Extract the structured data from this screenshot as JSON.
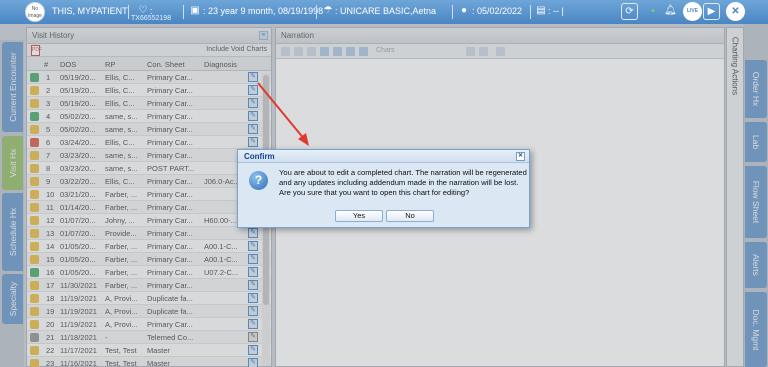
{
  "header": {
    "photo_label": "No Image",
    "patient_name": "THIS, MYPATIENT",
    "chart_id": "TX66552198",
    "age_dob": ": 23 year 9 month, 08/19/1998",
    "insurance": ": UNICARE BASIC,Aetna",
    "visit_date": ": 05/02/2022",
    "misc": ": -- |",
    "badge_label": "LIVE"
  },
  "left_tabs": [
    "Current Encounter",
    "Visit Hx",
    "Schedule Hx",
    "Specialty"
  ],
  "right_tabs": [
    "Order Hx",
    "Lab",
    "Flow Sheet",
    "Alerts",
    "Doc. Mgmt"
  ],
  "visit_history": {
    "title": "Visit History",
    "include_void": "Include Void Charts",
    "pdf_label": "PDF",
    "columns": [
      "#",
      "DOS",
      "RP",
      "Con. Sheet",
      "Diagnosis"
    ],
    "rows": [
      {
        "num": "1",
        "dos": "05/19/20...",
        "rp": "Ellis, C...",
        "sheet": "Primary Car...",
        "dx": "",
        "color": "#3aa55c"
      },
      {
        "num": "2",
        "dos": "05/19/20...",
        "rp": "Ellis, C...",
        "sheet": "Primary Car...",
        "dx": "",
        "color": "#e8b830"
      },
      {
        "num": "3",
        "dos": "05/19/20...",
        "rp": "Ellis, C...",
        "sheet": "Primary Car...",
        "dx": "",
        "color": "#e8b830"
      },
      {
        "num": "4",
        "dos": "05/02/20...",
        "rp": "same, s...",
        "sheet": "Primary Car...",
        "dx": "",
        "color": "#3aa55c"
      },
      {
        "num": "5",
        "dos": "05/02/20...",
        "rp": "same, s...",
        "sheet": "Primary Car...",
        "dx": "",
        "color": "#e8b830"
      },
      {
        "num": "6",
        "dos": "03/24/20...",
        "rp": "Ellis, C...",
        "sheet": "Primary Car...",
        "dx": "",
        "color": "#d84a3a"
      },
      {
        "num": "7",
        "dos": "03/23/20...",
        "rp": "same, s...",
        "sheet": "Primary Car...",
        "dx": "",
        "color": "#e8b830"
      },
      {
        "num": "8",
        "dos": "03/23/20...",
        "rp": "same, s...",
        "sheet": "POST PART...",
        "dx": "",
        "color": "#e8b830"
      },
      {
        "num": "9",
        "dos": "03/22/20...",
        "rp": "Ellis, C...",
        "sheet": "Primary Car...",
        "dx": "J06.0-Ac...",
        "color": "#e8b830"
      },
      {
        "num": "10",
        "dos": "03/21/20...",
        "rp": "Farber, ...",
        "sheet": "Primary Car...",
        "dx": "",
        "color": "#e8b830"
      },
      {
        "num": "11",
        "dos": "01/14/20...",
        "rp": "Farber, ...",
        "sheet": "Primary Car...",
        "dx": "",
        "color": "#e8b830"
      },
      {
        "num": "12",
        "dos": "01/07/20...",
        "rp": "Johny, ...",
        "sheet": "Primary Car...",
        "dx": "H60.00-...",
        "color": "#e8b830"
      },
      {
        "num": "13",
        "dos": "01/07/20...",
        "rp": "Provide...",
        "sheet": "Primary Car...",
        "dx": "",
        "color": "#e8b830"
      },
      {
        "num": "14",
        "dos": "01/05/20...",
        "rp": "Farber, ...",
        "sheet": "Primary Car...",
        "dx": "A00.1-C...",
        "color": "#e8b830"
      },
      {
        "num": "15",
        "dos": "01/05/20...",
        "rp": "Farber, ...",
        "sheet": "Primary Car...",
        "dx": "A00.1-C...",
        "color": "#e8b830"
      },
      {
        "num": "16",
        "dos": "01/05/20...",
        "rp": "Farber, ...",
        "sheet": "Primary Car...",
        "dx": "U07.2-C...",
        "color": "#3aa55c"
      },
      {
        "num": "17",
        "dos": "11/30/2021",
        "rp": "Farber, ...",
        "sheet": "Primary Car...",
        "dx": "",
        "color": "#e8b830"
      },
      {
        "num": "18",
        "dos": "11/19/2021",
        "rp": "A, Provi...",
        "sheet": "Duplicate fa...",
        "dx": "",
        "color": "#e8b830"
      },
      {
        "num": "19",
        "dos": "11/19/2021",
        "rp": "A, Provi...",
        "sheet": "Duplicate fa...",
        "dx": "",
        "color": "#e8b830"
      },
      {
        "num": "20",
        "dos": "11/19/2021",
        "rp": "A, Provi...",
        "sheet": "Primary Car...",
        "dx": "",
        "color": "#e8b830"
      },
      {
        "num": "21",
        "dos": "11/18/2021",
        "rp": "-",
        "sheet": "Telemed Co...",
        "dx": "",
        "color": "#8a8a8a"
      },
      {
        "num": "22",
        "dos": "11/17/2021",
        "rp": "Test, Test",
        "sheet": "Master",
        "dx": "",
        "color": "#e8b830"
      },
      {
        "num": "23",
        "dos": "11/16/2021",
        "rp": "Test, Test",
        "sheet": "Master",
        "dx": "",
        "color": "#e8b830"
      }
    ]
  },
  "narration": {
    "title": "Narration",
    "chars_label": "Chars"
  },
  "charting_actions": "Charting Actions",
  "dialog": {
    "title": "Confirm",
    "message": "You are about to edit a completed chart. The narration will be regenerated and any updates including addendum made in the narration will be lost. Are you sure that you want to open this chart for editing?",
    "yes_label": "Yes",
    "no_label": "No"
  },
  "colors": {
    "header_blue": "#4a86c4",
    "tab_blue": "#5b8fc7",
    "tab_active_green": "#8ab85a",
    "arrow_red": "#e03a2f"
  }
}
